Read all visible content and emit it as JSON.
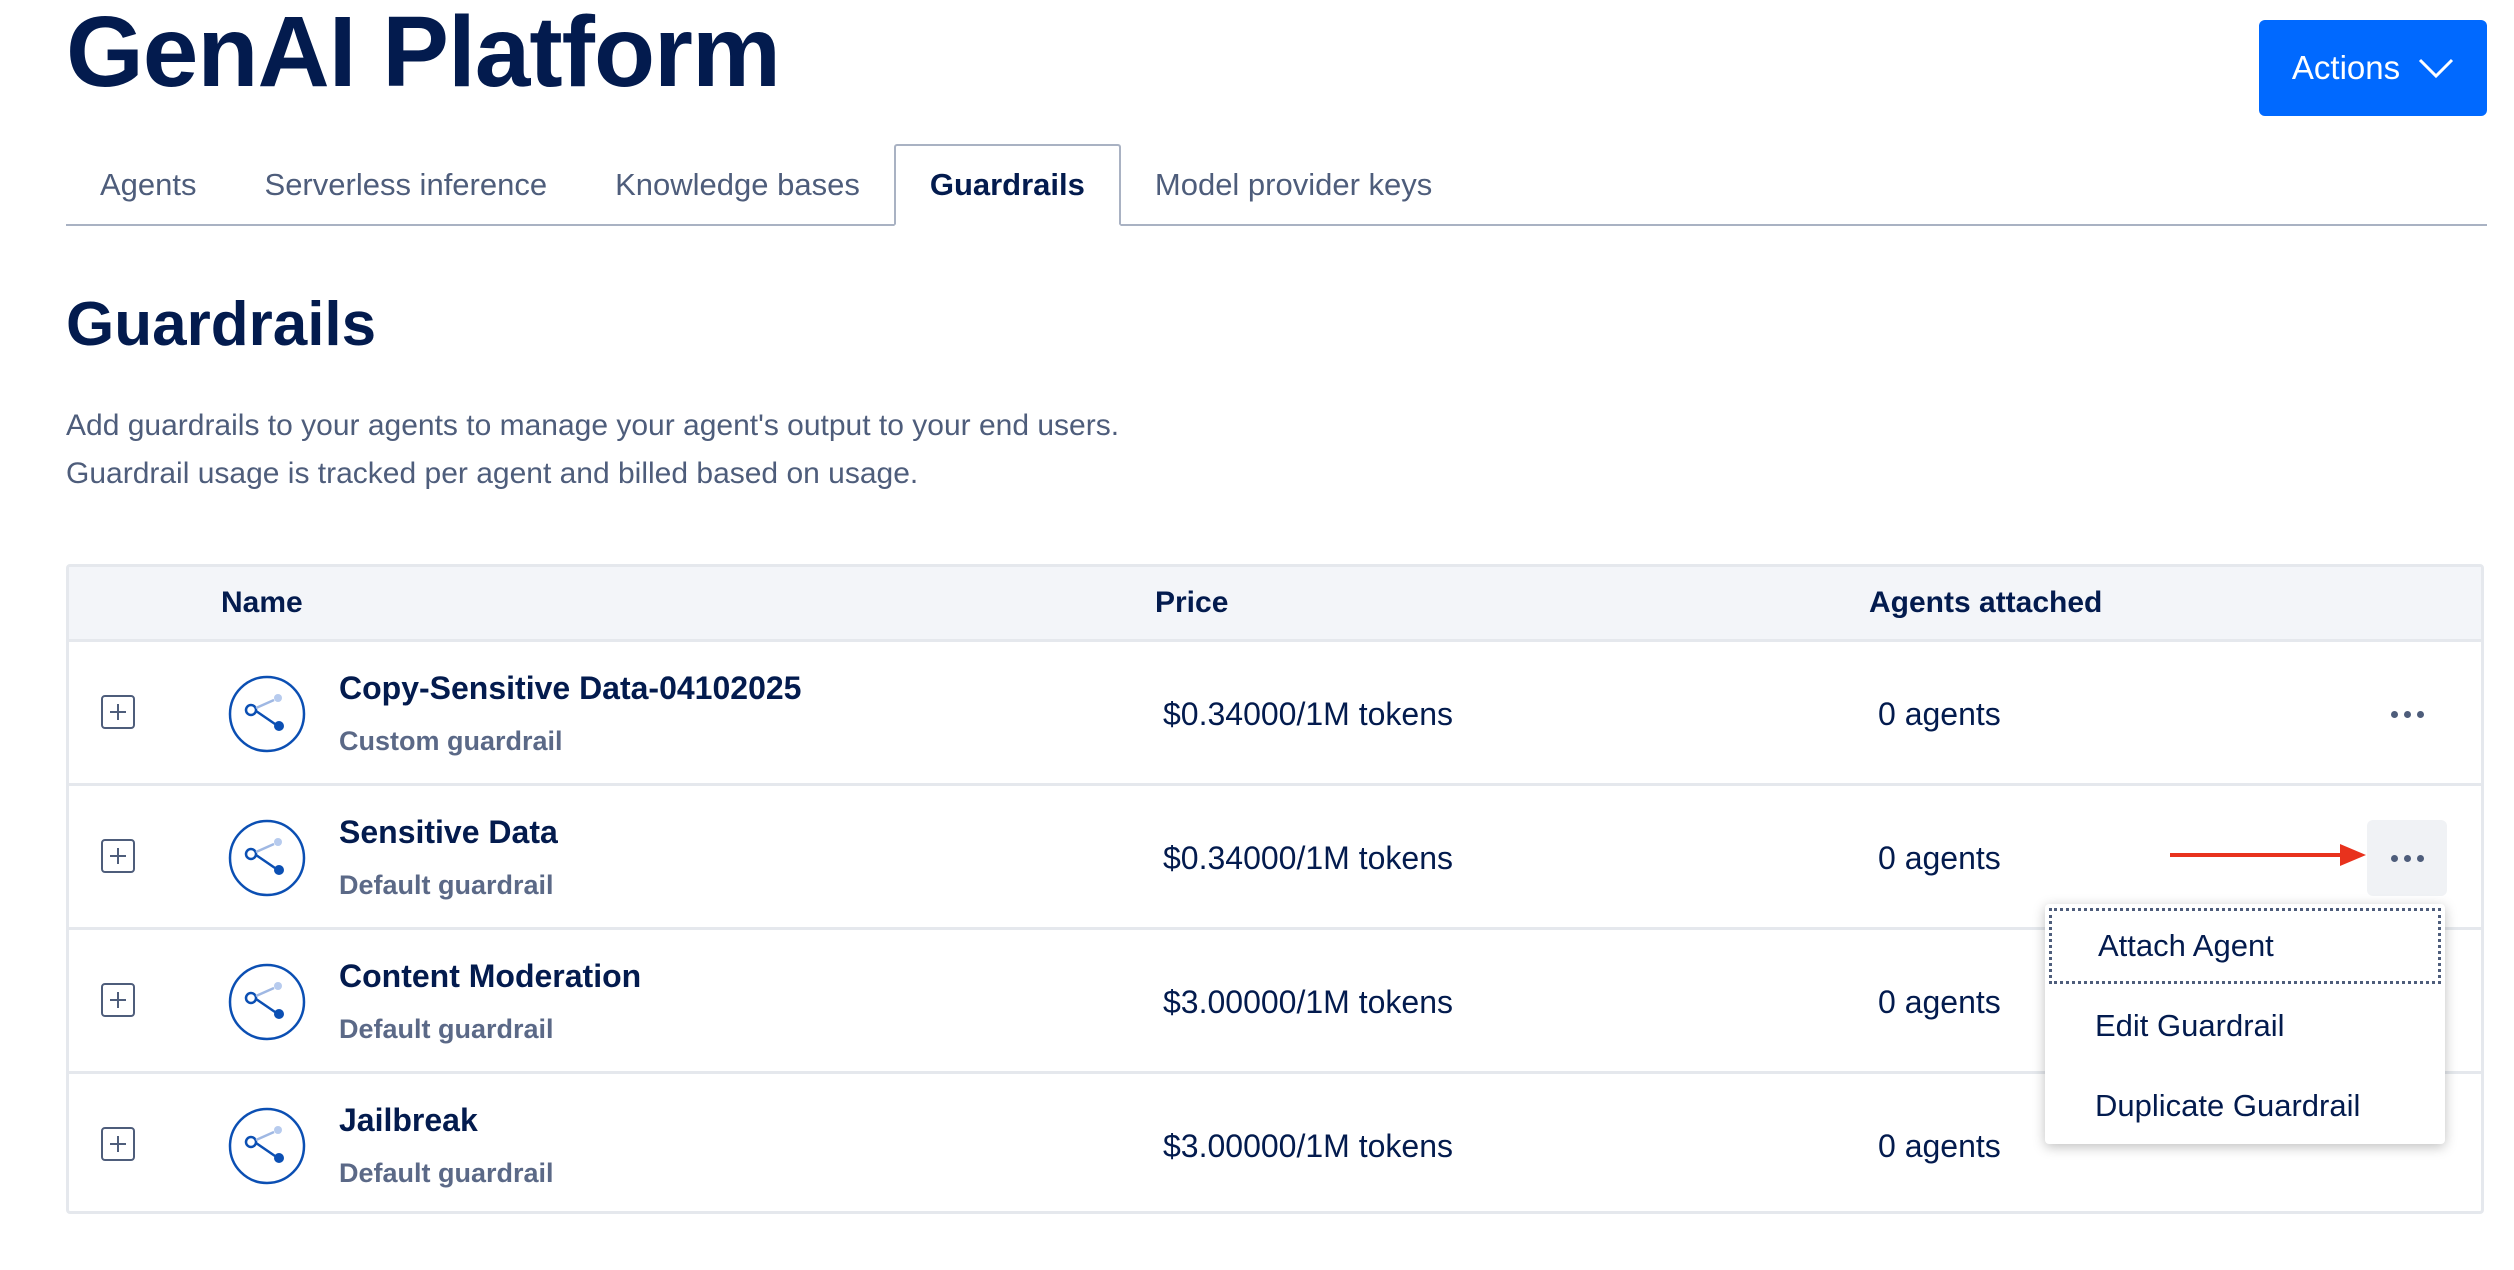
{
  "header": {
    "title": "GenAI Platform",
    "actions_label": "Actions"
  },
  "tabs": [
    {
      "label": "Agents",
      "active": false
    },
    {
      "label": "Serverless inference",
      "active": false
    },
    {
      "label": "Knowledge bases",
      "active": false
    },
    {
      "label": "Guardrails",
      "active": true
    },
    {
      "label": "Model provider keys",
      "active": false
    }
  ],
  "section": {
    "title": "Guardrails",
    "description_line1": "Add guardrails to your agents to manage your agent's output to your end users.",
    "description_line2": "Guardrail usage is tracked per agent and billed based on usage."
  },
  "table": {
    "columns": {
      "name": "Name",
      "price": "Price",
      "agents": "Agents attached"
    },
    "rows": [
      {
        "name": "Copy-Sensitive Data-04102025",
        "type": "Custom guardrail",
        "price": "$0.34000/1M tokens",
        "agents": "0 agents"
      },
      {
        "name": "Sensitive Data",
        "type": "Default guardrail",
        "price": "$0.34000/1M tokens",
        "agents": "0 agents"
      },
      {
        "name": "Content Moderation",
        "type": "Default guardrail",
        "price": "$3.00000/1M tokens",
        "agents": "0 agents"
      },
      {
        "name": "Jailbreak",
        "type": "Default guardrail",
        "price": "$3.00000/1M tokens",
        "agents": "0 agents"
      }
    ]
  },
  "context_menu": {
    "items": [
      "Attach Agent",
      "Edit Guardrail",
      "Duplicate Guardrail"
    ]
  },
  "colors": {
    "primary": "#0069ff",
    "heading": "#031b4e",
    "muted": "#4e5d7b",
    "annotation_arrow": "#e8321d"
  }
}
